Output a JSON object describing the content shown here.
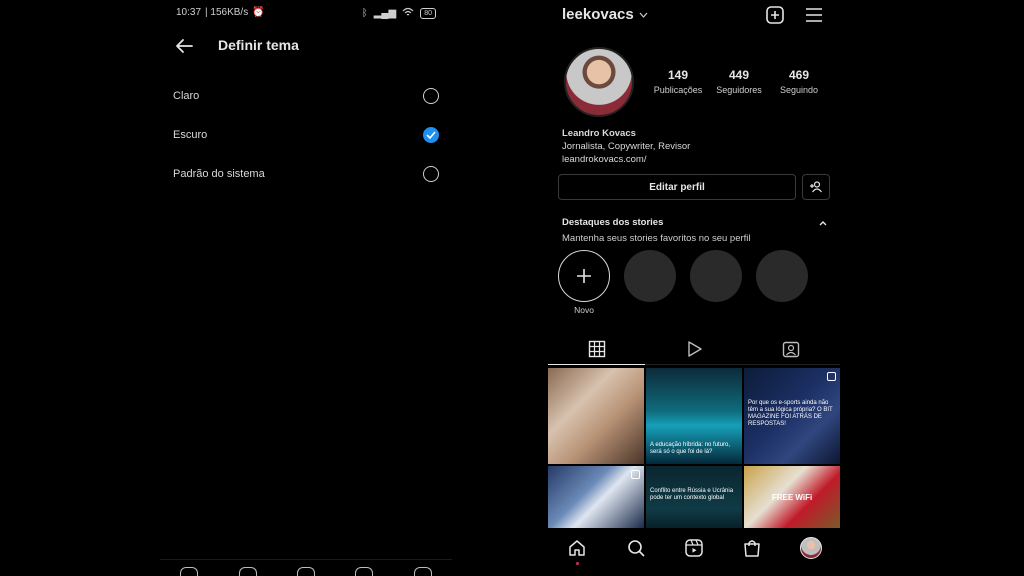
{
  "left": {
    "status": {
      "time": "10:37",
      "speed": "| 156KB/s",
      "battery": "80"
    },
    "title": "Definir tema",
    "options": [
      {
        "label": "Claro",
        "selected": false
      },
      {
        "label": "Escuro",
        "selected": true
      },
      {
        "label": "Padrão do sistema",
        "selected": false
      }
    ]
  },
  "right": {
    "username": "leekovacs",
    "avatar": "profile-photo",
    "stats": [
      {
        "value": "149",
        "label": "Publicações"
      },
      {
        "value": "449",
        "label": "Seguidores"
      },
      {
        "value": "469",
        "label": "Seguindo"
      }
    ],
    "bio": {
      "name": "Leandro Kovacs",
      "description": "Jornalista, Copywriter, Revisor",
      "link": "leandrokovacs.com/"
    },
    "edit_profile_label": "Editar perfil",
    "highlights": {
      "title": "Destaques dos stories",
      "subtitle": "Mantenha seus stories favoritos no seu perfil",
      "new_label": "Novo"
    },
    "posts": [
      {
        "caption": ""
      },
      {
        "caption": "A educação híbrida: no futuro, será só o que foi de lá?"
      },
      {
        "caption": "Por que os e-sports ainda não têm a sua lógica própria?  O BIT MAGAZINE FOI ATRÁS DE RESPOSTAS!"
      },
      {
        "caption": ""
      },
      {
        "caption": "Conflito entre Rússia e Ucrânia pode ter um contexto global"
      },
      {
        "caption": "FREE WiFi"
      }
    ],
    "colors": {
      "accent": "#1f8ff0",
      "notification": "#e0245e",
      "background": "#000000"
    }
  }
}
